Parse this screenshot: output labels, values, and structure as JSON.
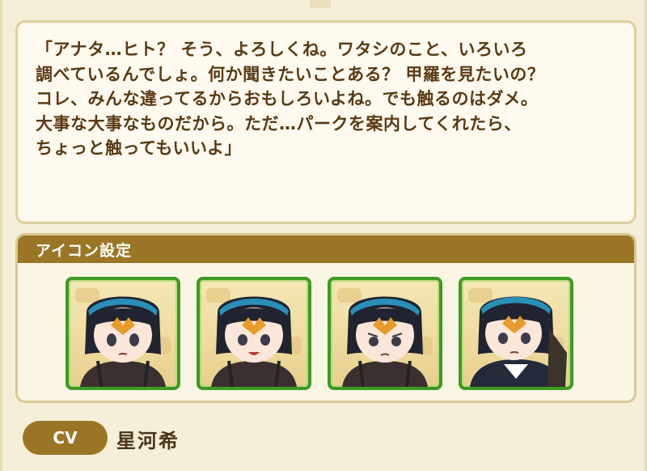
{
  "dialogue": {
    "text": "「アナタ…ヒト？ そう、よろしくね。ワタシのこと、いろいろ\n調べているんでしょ。何か聞きたいことある？ 甲羅を見たいの？\nコレ、みんな違ってるからおもしろいよね。でも触るのはダメ。\n大事な大事なものだから。ただ…パークを案内してくれたら、\nちょっと触ってもいいよ」"
  },
  "icon_settings": {
    "title": "アイコン設定",
    "icons": [
      {
        "expression": "neutral"
      },
      {
        "expression": "smile"
      },
      {
        "expression": "sad"
      },
      {
        "expression": "serious"
      }
    ]
  },
  "cv": {
    "label": "CV",
    "name": "星河希"
  },
  "colors": {
    "header_brown": "#9a7626",
    "text_brown": "#5a3a12",
    "icon_border_green": "#3e9a22",
    "panel_bg": "#fbf6e4"
  }
}
